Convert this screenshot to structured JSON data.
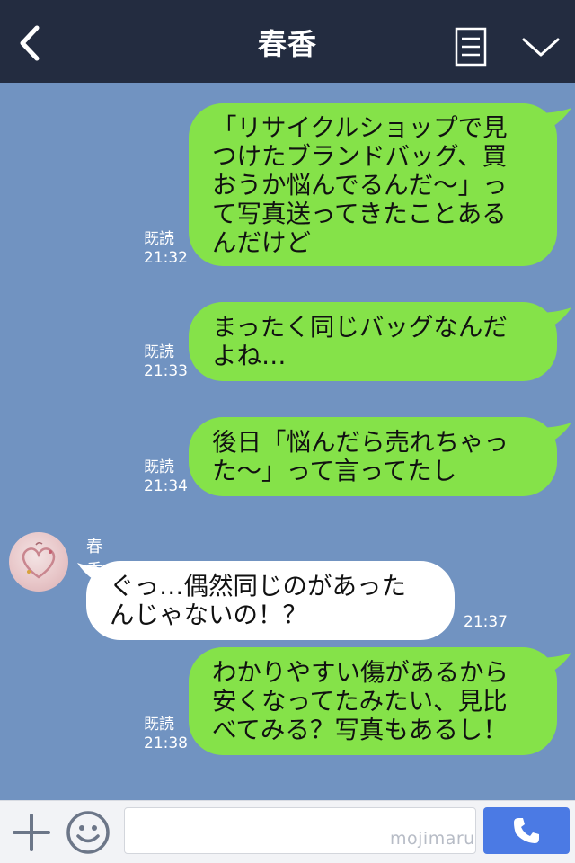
{
  "header": {
    "title": "春香",
    "back_icon": "chevron-left-icon",
    "menu_icon": "list-menu-icon",
    "collapse_icon": "chevron-down-icon"
  },
  "messages": [
    {
      "direction": "outgoing",
      "text": "「リサイクルショップで見\nつけたブランドバッグ、買\nおうか悩んでるんだ〜」っ\nて写真送ってきたことある\nんだけど",
      "read": "既読",
      "time": "21:32"
    },
    {
      "direction": "outgoing",
      "text": "まったく同じバッグなんだ\nよね…",
      "read": "既読",
      "time": "21:33"
    },
    {
      "direction": "outgoing",
      "text": "後日「悩んだら売れちゃっ\nた〜」って言ってたし",
      "read": "既読",
      "time": "21:34"
    },
    {
      "direction": "incoming",
      "sender": "春香",
      "text": "ぐっ…偶然同じのがあった\nんじゃないの！？",
      "time": "21:37"
    },
    {
      "direction": "outgoing",
      "text": "わかりやすい傷があるから\n安くなってたみたい、見比\nべてみる？写真もあるし！",
      "read": "既読",
      "time": "21:38"
    }
  ],
  "input": {
    "value": "",
    "placeholder": "",
    "watermark": "mojimaru"
  },
  "colors": {
    "header_bg": "#232c40",
    "chat_bg": "#7193c1",
    "outgoing_bubble": "#85e249",
    "incoming_bubble": "#ffffff",
    "call_button": "#4b7ae4"
  }
}
